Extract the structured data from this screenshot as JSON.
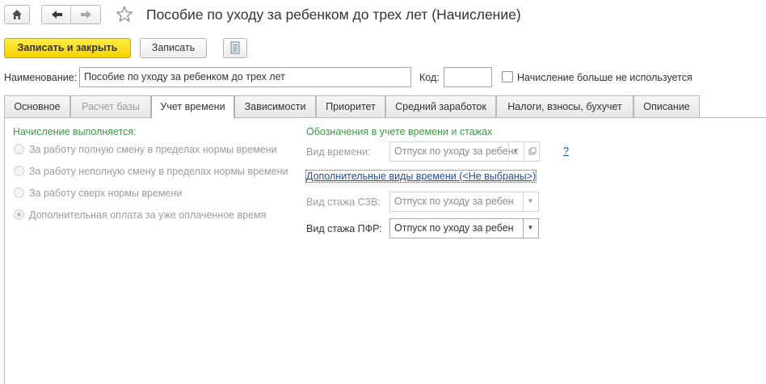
{
  "window": {
    "title": "Пособие по уходу за ребенком до трех лет (Начисление)"
  },
  "toolbar": {
    "save_close_label": "Записать и закрыть",
    "save_label": "Записать"
  },
  "header": {
    "name_label": "Наименование:",
    "name_value": "Пособие по уходу за ребенком до трех лет",
    "code_label": "Код:",
    "code_value": "",
    "unused_label": "Начисление больше не используется",
    "unused_checked": false
  },
  "tabs": [
    {
      "label": "Основное",
      "state": "normal"
    },
    {
      "label": "Расчет базы",
      "state": "disabled"
    },
    {
      "label": "Учет времени",
      "state": "active"
    },
    {
      "label": "Зависимости",
      "state": "normal"
    },
    {
      "label": "Приоритет",
      "state": "normal"
    },
    {
      "label": "Средний заработок",
      "state": "normal"
    },
    {
      "label": "Налоги, взносы, бухучет",
      "state": "normal"
    },
    {
      "label": "Описание",
      "state": "normal"
    }
  ],
  "left_group": {
    "title": "Начисление выполняется:",
    "options": [
      {
        "label": "За работу полную смену в пределах нормы времени",
        "checked": false
      },
      {
        "label": "За работу неполную смену в пределах нормы времени",
        "checked": false
      },
      {
        "label": "За работу сверх нормы времени",
        "checked": false
      },
      {
        "label": "Дополнительная оплата за уже оплаченное время",
        "checked": true
      }
    ]
  },
  "right_group": {
    "title": "Обозначения в учете времени и стажах",
    "time_kind_label": "Вид времени:",
    "time_kind_value": "Отпуск по уходу за ребенк",
    "help_label": "?",
    "extra_link": "Дополнительные виды времени (<Не выбраны>)",
    "szv_label": "Вид стажа СЗВ:",
    "szv_value": "Отпуск по уходу за ребен",
    "pfr_label": "Вид стажа ПФР:",
    "pfr_value": "Отпуск по уходу за ребен"
  },
  "colors": {
    "primary_button": "#f4d200",
    "group_title_green": "#3a9a45",
    "link_blue": "#1f4fa8"
  },
  "icons": {
    "home": "home-icon",
    "back": "arrow-left-icon",
    "forward": "arrow-right-icon",
    "favorite": "star-icon",
    "report": "document-list-icon",
    "dropdown": "triangle-down-icon",
    "open": "open-copy-icon"
  }
}
